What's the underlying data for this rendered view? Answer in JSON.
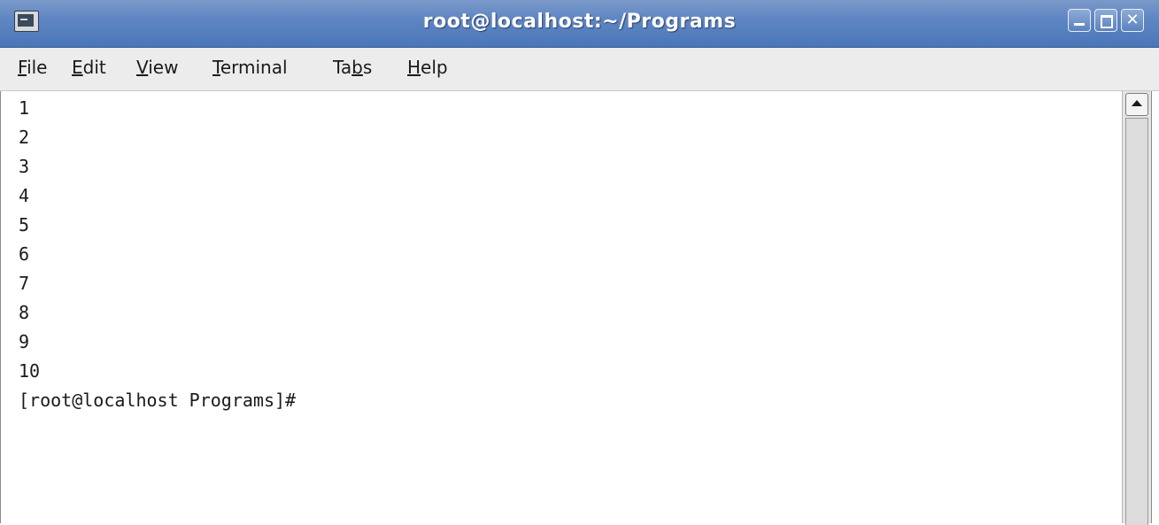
{
  "window": {
    "title": "root@localhost:~/Programs",
    "icon": "terminal-icon",
    "buttons": {
      "minimize": "minimize-icon",
      "maximize": "maximize-icon",
      "close": "close-icon",
      "close_glyph": "✕"
    }
  },
  "menu": {
    "items": [
      {
        "pre": "",
        "u": "F",
        "post": "ile"
      },
      {
        "pre": "",
        "u": "E",
        "post": "dit"
      },
      {
        "pre": "",
        "u": "V",
        "post": "iew"
      },
      {
        "pre": "",
        "u": "T",
        "post": "erminal"
      },
      {
        "pre": "Ta",
        "u": "b",
        "post": "s"
      },
      {
        "pre": "",
        "u": "H",
        "post": "elp"
      }
    ]
  },
  "terminal": {
    "lines": [
      "1",
      "2",
      "3",
      "4",
      "5",
      "6",
      "7",
      "8",
      "9",
      "10",
      "[root@localhost Programs]#"
    ]
  },
  "colors": {
    "titlebar": "#5f86c3",
    "menubar": "#ececec",
    "terminal_bg": "#ffffff",
    "terminal_fg": "#1a1a1a"
  }
}
